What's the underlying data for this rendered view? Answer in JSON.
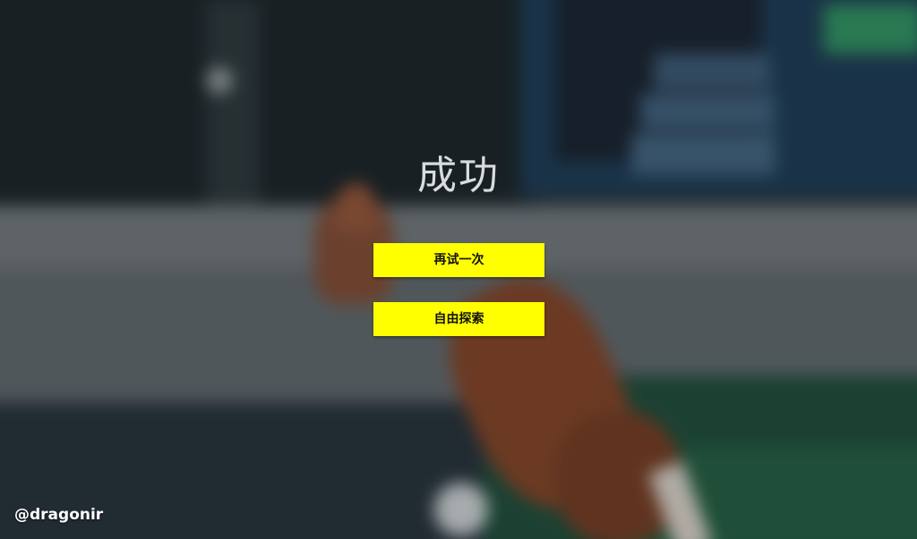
{
  "dialog": {
    "title": "成功",
    "buttons": {
      "retry_label": "再试一次",
      "explore_label": "自由探索"
    }
  },
  "watermark": "@dragonir",
  "colors": {
    "button_bg": "#ffff00",
    "title_text": "#d9dcde"
  }
}
